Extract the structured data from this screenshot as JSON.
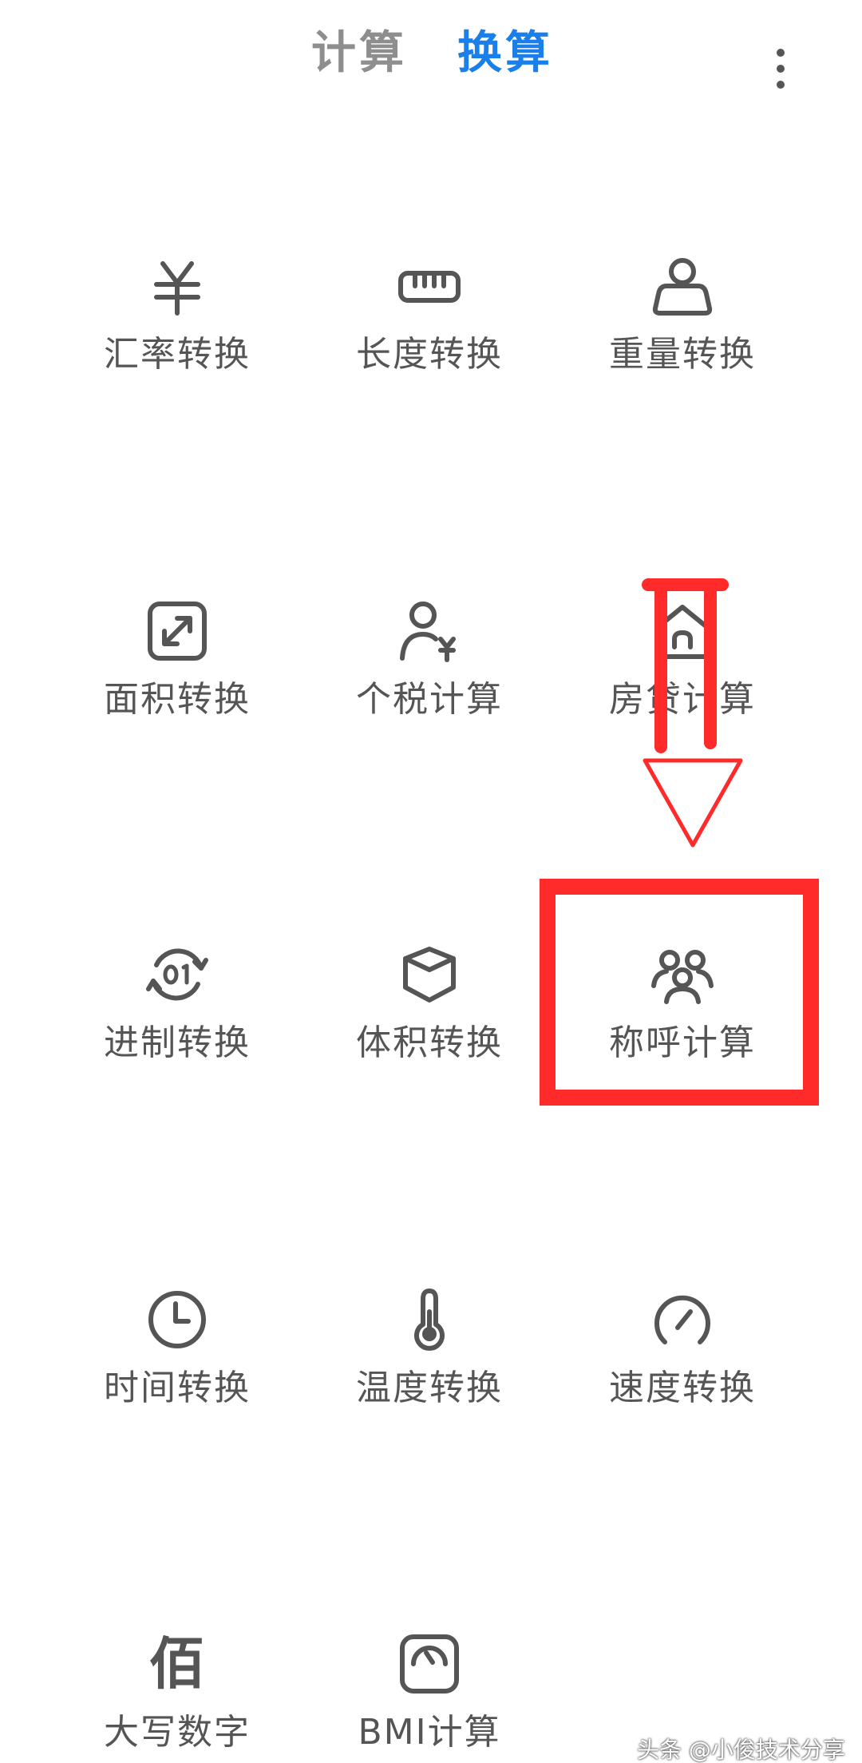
{
  "header": {
    "tabs": [
      {
        "label": "计算",
        "active": false
      },
      {
        "label": "换算",
        "active": true
      }
    ],
    "more_icon": "more-vertical-icon"
  },
  "colors": {
    "active_tab": "#1a7fe8",
    "inactive_tab": "#8e8e8e",
    "icon": "#555555",
    "annotation": "#ff2a2a"
  },
  "grid": {
    "items": [
      {
        "label": "汇率转换",
        "icon": "currency-yuan-icon"
      },
      {
        "label": "长度转换",
        "icon": "ruler-icon"
      },
      {
        "label": "重量转换",
        "icon": "weight-icon"
      },
      {
        "label": "面积转换",
        "icon": "area-expand-icon"
      },
      {
        "label": "个税计算",
        "icon": "person-tax-icon"
      },
      {
        "label": "房贷计算",
        "icon": "house-icon"
      },
      {
        "label": "进制转换",
        "icon": "binary-cycle-icon"
      },
      {
        "label": "体积转换",
        "icon": "cube-icon"
      },
      {
        "label": "称呼计算",
        "icon": "people-group-icon"
      },
      {
        "label": "时间转换",
        "icon": "clock-icon"
      },
      {
        "label": "温度转换",
        "icon": "thermometer-icon"
      },
      {
        "label": "速度转换",
        "icon": "speedometer-icon"
      },
      {
        "label": "大写数字",
        "icon": "capital-number-icon",
        "glyph": "佰"
      },
      {
        "label": "BMI计算",
        "icon": "scale-gauge-icon"
      }
    ]
  },
  "watermark": "头条 @小俊技术分享"
}
